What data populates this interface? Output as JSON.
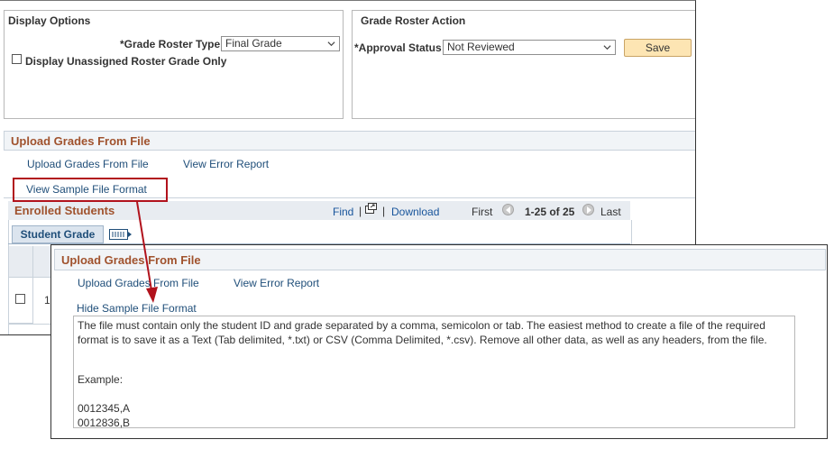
{
  "display_options": {
    "title": "Display Options",
    "grade_roster_type_label": "*Grade Roster Type",
    "grade_roster_type_value": "Final Grade",
    "unassigned_only_label": "Display Unassigned Roster Grade Only"
  },
  "grade_roster_action": {
    "title": "Grade Roster Action",
    "approval_status_label": "*Approval Status",
    "approval_status_value": "Not Reviewed",
    "save_label": "Save"
  },
  "upload_section": {
    "title": "Upload Grades From File",
    "upload_link": "Upload Grades From File",
    "error_report_link": "View Error Report",
    "view_sample_link": "View Sample File Format"
  },
  "enrolled_students": {
    "title": "Enrolled Students",
    "find": "Find",
    "separator": "|",
    "download": "Download",
    "first": "First",
    "range": "1-25 of 25",
    "last": "Last",
    "tab_label": "Student Grade",
    "row_number_partial": "1"
  },
  "popup": {
    "title": "Upload Grades From File",
    "upload_link": "Upload Grades From File",
    "error_report_link": "View Error Report",
    "hide_sample_link": "Hide Sample File Format",
    "description": "The file must contain only the student ID and grade separated by a comma, semicolon or tab. The easiest method to create a file of the required format is to save it as a Text (Tab delimited, *.txt) or CSV (Comma Delimited, *.csv). Remove all other data, as well as any headers, from the file.",
    "example_label": "Example:",
    "example_lines": [
      "0012345,A",
      "0012836,B"
    ]
  },
  "colors": {
    "section_title": "#a0522d",
    "link": "#1f4e79",
    "highlight": "#b1121c",
    "save_button": "#fde5b3"
  }
}
